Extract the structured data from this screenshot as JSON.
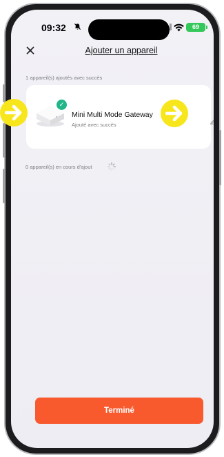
{
  "status_bar": {
    "time": "09:32",
    "bell_icon": "bell-slash-icon",
    "signal_icon": "cellular-signal-icon",
    "wifi_icon": "wifi-icon",
    "battery": "69"
  },
  "header": {
    "close_icon": "close-icon",
    "title": "Ajouter un appareil"
  },
  "success_section": {
    "label": "1 appareil(s) ajoutés avec succès"
  },
  "device": {
    "name": "Mini Multi Mode Gateway",
    "status": "Ajouté avec succès",
    "image_icon": "gateway-device-icon",
    "check_icon": "check-icon",
    "edit_icon": "pencil-icon"
  },
  "progress_section": {
    "label": "0 appareil(s) en cours d'ajout",
    "spinner_icon": "loading-spinner-icon"
  },
  "footer": {
    "done_label": "Terminé"
  },
  "annotations": {
    "arrow_icon": "arrow-right-icon"
  },
  "colors": {
    "accent": "#f85a2d",
    "success": "#21b58a",
    "annotation_arrow": "#f8e61c",
    "battery": "#34c759"
  }
}
